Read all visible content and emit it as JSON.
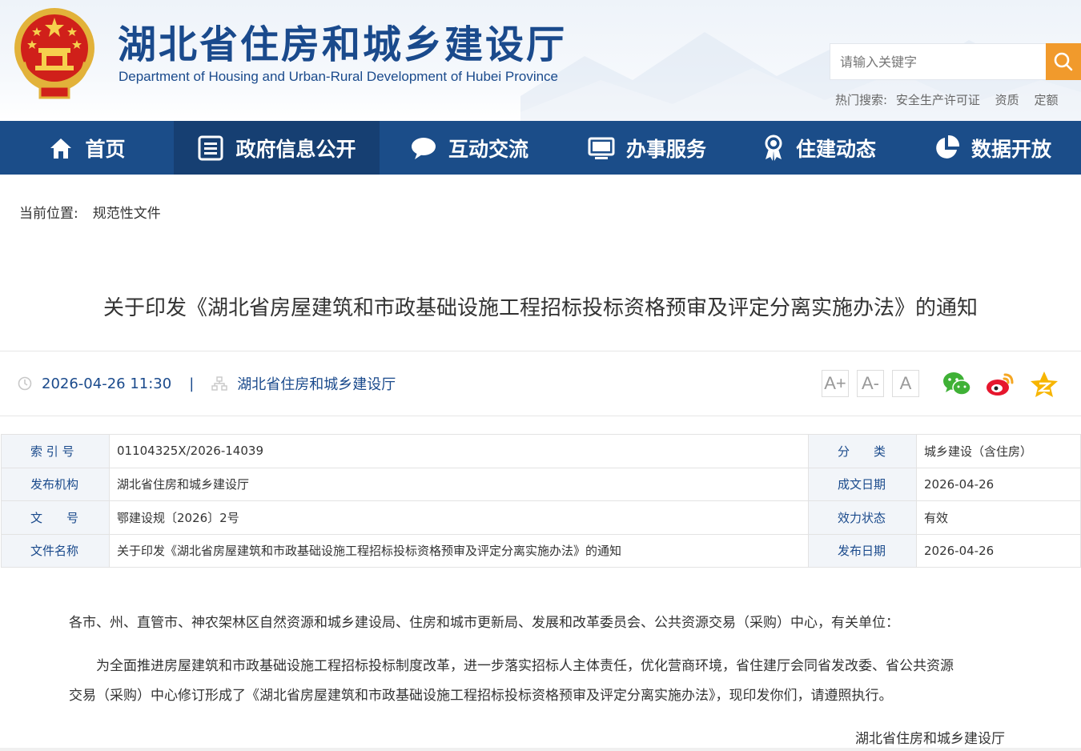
{
  "header": {
    "title_cn": "湖北省住房和城乡建设厅",
    "title_en": "Department of Housing and Urban-Rural Development of Hubei Province",
    "search_placeholder": "请输入关键字",
    "hot_label": "热门搜索:",
    "hot_links": [
      "安全生产许可证",
      "资质",
      "定额"
    ]
  },
  "nav": {
    "items": [
      {
        "label": "首页",
        "icon": "home-icon"
      },
      {
        "label": "政府信息公开",
        "icon": "document-list-icon"
      },
      {
        "label": "互动交流",
        "icon": "chat-bubble-icon"
      },
      {
        "label": "办事服务",
        "icon": "monitor-icon"
      },
      {
        "label": "住建动态",
        "icon": "award-icon"
      },
      {
        "label": "数据开放",
        "icon": "pie-chart-icon"
      }
    ],
    "active_index": 1
  },
  "breadcrumb": {
    "label": "当前位置:",
    "current": "规范性文件"
  },
  "article": {
    "title": "关于印发《湖北省房屋建筑和市政基础设施工程招标投标资格预审及评定分离实施办法》的通知",
    "datetime": "2026-04-26 11:30",
    "separator": "|",
    "source": "湖北省住房和城乡建设厅",
    "font_buttons": [
      "A+",
      "A-",
      "A"
    ],
    "share_icons": [
      "wechat-icon",
      "weibo-icon",
      "qzone-icon"
    ]
  },
  "info_table": {
    "rows": [
      {
        "k1": "索 引 号",
        "v1": "01104325X/2026-14039",
        "k2": "分　　类",
        "v2": "城乡建设（含住房）"
      },
      {
        "k1": "发布机构",
        "v1": "湖北省住房和城乡建设厅",
        "k2": "成文日期",
        "v2": "2026-04-26"
      },
      {
        "k1": "文　　号",
        "v1": "鄂建设规〔2026〕2号",
        "k2": "效力状态",
        "v2": "有效"
      },
      {
        "k1": "文件名称",
        "v1": "关于印发《湖北省房屋建筑和市政基础设施工程招标投标资格预审及评定分离实施办法》的通知",
        "k2": "发布日期",
        "v2": "2026-04-26"
      }
    ]
  },
  "body": {
    "greeting": "各市、州、直管市、神农架林区自然资源和城乡建设局、住房和城市更新局、发展和改革委员会、公共资源交易（采购）中心，有关单位：",
    "para1_line1": "　　为全面推进房屋建筑和市政基础设施工程招标投标制度改革，进一步落实招标人主体责任，优化营商环境，省住建厅会同省发改委、省公共资源",
    "para1_line2": "交易（采购）中心修订形成了《湖北省房屋建筑和市政基础设施工程招标投标资格预审及评定分离实施办法》，现印发你们，请遵照执行。",
    "signature": "湖北省住房和城乡建设厅"
  },
  "colors": {
    "nav_bg": "#1b4d89",
    "nav_active": "#163f72",
    "brand_blue": "#1a4a8c",
    "search_button": "#f19a2c",
    "table_key_bg": "#f2f5f9"
  }
}
